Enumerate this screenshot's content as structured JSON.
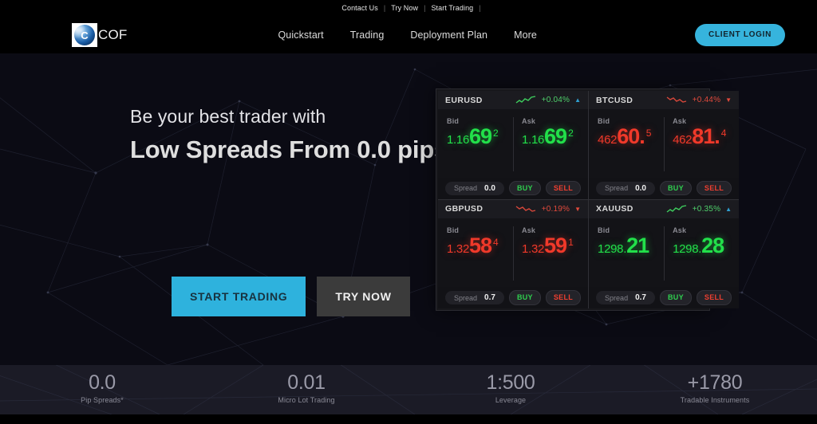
{
  "topbar": {
    "links": [
      {
        "label": "Contact Us"
      },
      {
        "label": "Try Now"
      },
      {
        "label": "Start Trading"
      }
    ],
    "separator": "|"
  },
  "header": {
    "logo_icon": "cof-sphere-logo-icon",
    "brand_name": "COF",
    "nav": [
      {
        "label": "Quickstart"
      },
      {
        "label": "Trading"
      },
      {
        "label": "Deployment Plan"
      },
      {
        "label": "More"
      }
    ],
    "login_label": "CLIENT LOGIN",
    "login_color": "#36b4dd"
  },
  "hero": {
    "subheading": "Be your best trader with",
    "heading": "Low Spreads From 0.0 pips",
    "cta_primary": "START TRADING",
    "cta_secondary": "TRY NOW",
    "cta_primary_color": "#2eb2dd",
    "cta_secondary_color": "#3b3b3b"
  },
  "quotes": {
    "bid_label": "Bid",
    "ask_label": "Ask",
    "spread_label": "Spread",
    "buy_label": "BUY",
    "sell_label": "SELL",
    "up_arrow": "▲",
    "down_arrow": "▼",
    "up_color": "#22e04a",
    "down_color": "#f0392a",
    "items": [
      {
        "symbol": "EURUSD",
        "change": "+0.04%",
        "direction": "up",
        "spark": "up",
        "bid_lead": "1.16",
        "bid_big": "69",
        "bid_sup": "2",
        "ask_lead": "1.16",
        "ask_big": "69",
        "ask_sup": "2",
        "spread": "0.0"
      },
      {
        "symbol": "BTCUSD",
        "change": "+0.44%",
        "direction": "down",
        "spark": "down",
        "bid_lead": "462",
        "bid_big": "60.",
        "bid_sup": "5",
        "ask_lead": "462",
        "ask_big": "81.",
        "ask_sup": "4",
        "spread": "0.0"
      },
      {
        "symbol": "GBPUSD",
        "change": "+0.19%",
        "direction": "down",
        "spark": "down",
        "bid_lead": "1.32",
        "bid_big": "58",
        "bid_sup": "4",
        "ask_lead": "1.32",
        "ask_big": "59",
        "ask_sup": "1",
        "spread": "0.7"
      },
      {
        "symbol": "XAUUSD",
        "change": "+0.35%",
        "direction": "up",
        "spark": "up",
        "bid_lead": "1298.",
        "bid_big": "21",
        "bid_sup": "",
        "ask_lead": "1298.",
        "ask_big": "28",
        "ask_sup": "",
        "spread": "0.7"
      }
    ]
  },
  "stats": [
    {
      "value": "0.0",
      "label": "Pip Spreads*"
    },
    {
      "value": "0.01",
      "label": "Micro Lot Trading"
    },
    {
      "value": "1:500",
      "label": "Leverage"
    },
    {
      "value": "+1780",
      "label": "Tradable Instruments"
    }
  ]
}
